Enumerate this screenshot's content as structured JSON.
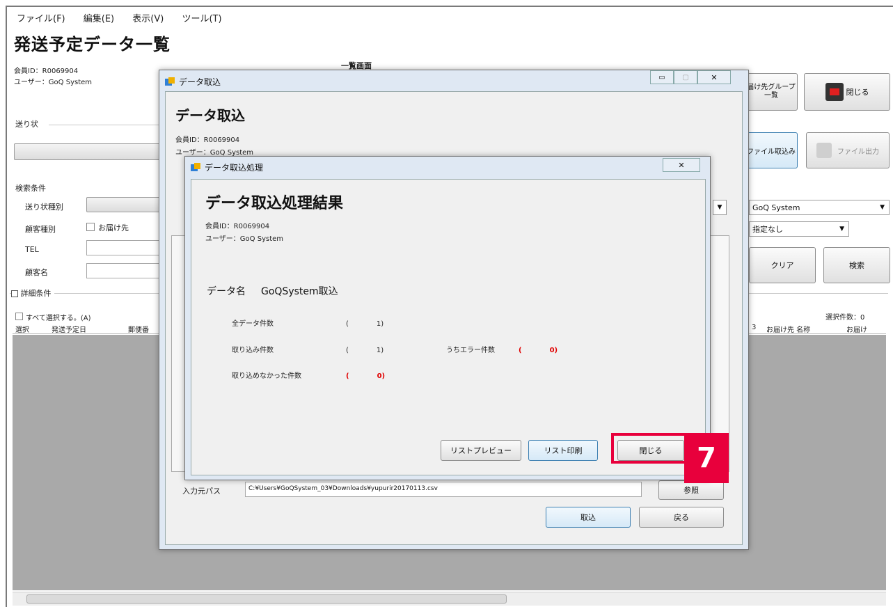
{
  "main": {
    "menu": [
      "ファイル(F)",
      "編集(E)",
      "表示(V)",
      "ツール(T)"
    ],
    "title": "発送予定データ一覧",
    "member_id": "会員ID：R0069904",
    "user": "ユーザー：GoQ System",
    "list_screen_label": "一覧画面",
    "invoice_group": "送り状",
    "search_group": "検索条件",
    "invoice_type_label": "送り状種別",
    "customer_type_label": "顧客種別",
    "customer_option": "お届け先",
    "tel_label": "TEL",
    "customer_name_label": "顧客名",
    "detail_group": "詳細条件",
    "select_all": "すべて選択する。(A)",
    "selected_count": "選択件数：0",
    "columns_left": [
      "選択",
      "発送予定日",
      "郵便番"
    ],
    "columns_right": [
      "3",
      "お届け先 名称",
      "お届け"
    ],
    "top_right_buttons": {
      "delivery_group": "届け先グループ一覧",
      "close": "閉じる"
    },
    "file_import": "ファイル取込み",
    "file_export": "ファイル出力",
    "user_combo": "GoQ System",
    "assign_combo": "指定なし",
    "clear": "クリア",
    "search": "検索"
  },
  "import_dialog": {
    "window_title": "データ取込",
    "heading": "データ取込",
    "member_id": "会員ID：R0069904",
    "user": "ユーザー：GoQ System",
    "path_label": "入力元パス",
    "path_value": "C:¥Users¥GoQSystem_03¥Downloads¥yupurir20170113.csv",
    "browse": "参照",
    "import_btn": "取込",
    "back_btn": "戻る"
  },
  "result_dialog": {
    "window_title": "データ取込処理",
    "heading": "データ取込処理結果",
    "member_id": "会員ID：R0069904",
    "user": "ユーザー：GoQ System",
    "data_name_label": "データ名",
    "data_name_value": "GoQSystem取込",
    "total_label": "全データ件数",
    "total_value": "(　　　　1)",
    "imported_label": "取り込み件数",
    "imported_value": "(　　　　1)",
    "error_label": "うちエラー件数",
    "error_value": "(　　　　0)",
    "not_imported_label": "取り込めなかった件数",
    "not_imported_value": "(　　　　0)",
    "preview_btn": "リストプレビュー",
    "print_btn": "リスト印刷",
    "close_btn": "閉じる"
  },
  "annotation": {
    "step": "7",
    "color": "#e8003c"
  }
}
